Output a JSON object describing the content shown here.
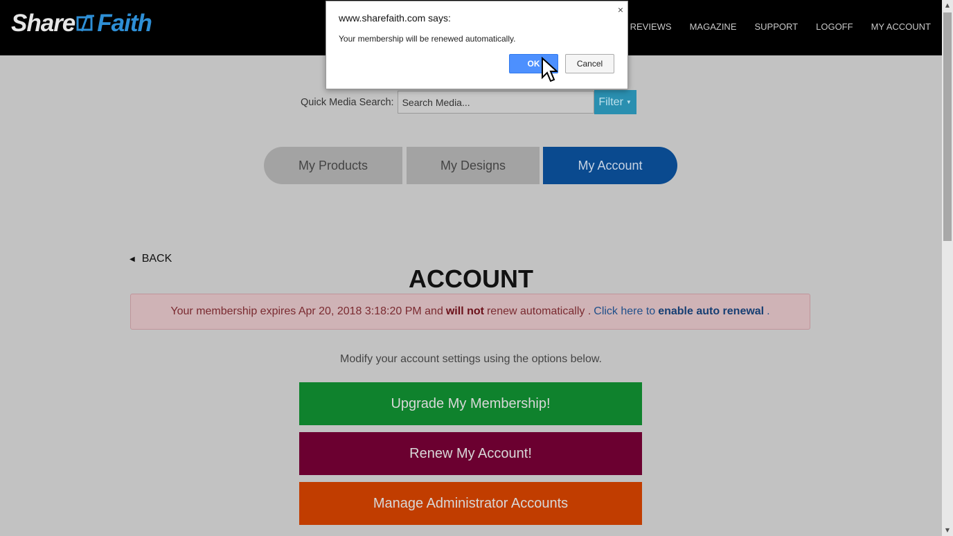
{
  "header": {
    "logo_left": "Share",
    "logo_right": "Faith",
    "nav": [
      "REVIEWS",
      "MAGAZINE",
      "SUPPORT",
      "LOGOFF",
      "MY ACCOUNT"
    ]
  },
  "search": {
    "label": "Quick Media Search:",
    "placeholder": "Search Media...",
    "filter_label": "Filter"
  },
  "tabs": [
    {
      "label": "My Products"
    },
    {
      "label": "My Designs"
    },
    {
      "label": "My Account",
      "active": true
    }
  ],
  "back_label": "BACK",
  "page_title": "ACCOUNT",
  "alert": {
    "text_start": "Your membership expires Apr 20, 2018 3:18:20 PM and",
    "emphasis": "will not",
    "text_end": "renew automatically .",
    "link_start": "Click here to",
    "link_bold": "enable auto renewal",
    "link_end": "."
  },
  "hint": "Modify your account settings using the options below.",
  "buttons": {
    "upgrade": "Upgrade My Membership!",
    "renew": "Renew My Account!",
    "admin": "Manage Administrator Accounts"
  },
  "dialog": {
    "title": "www.sharefaith.com says:",
    "message": "Your membership will be renewed automatically.",
    "ok": "OK",
    "cancel": "Cancel",
    "close": "×"
  },
  "colors": {
    "header_bg": "#000000",
    "tab_active": "#0a4a8f",
    "filter": "#2a8fb0",
    "upgrade": "#0f822d",
    "renew": "#6b0030",
    "admin": "#c13d00",
    "dialog_ok": "#4d90fe"
  }
}
